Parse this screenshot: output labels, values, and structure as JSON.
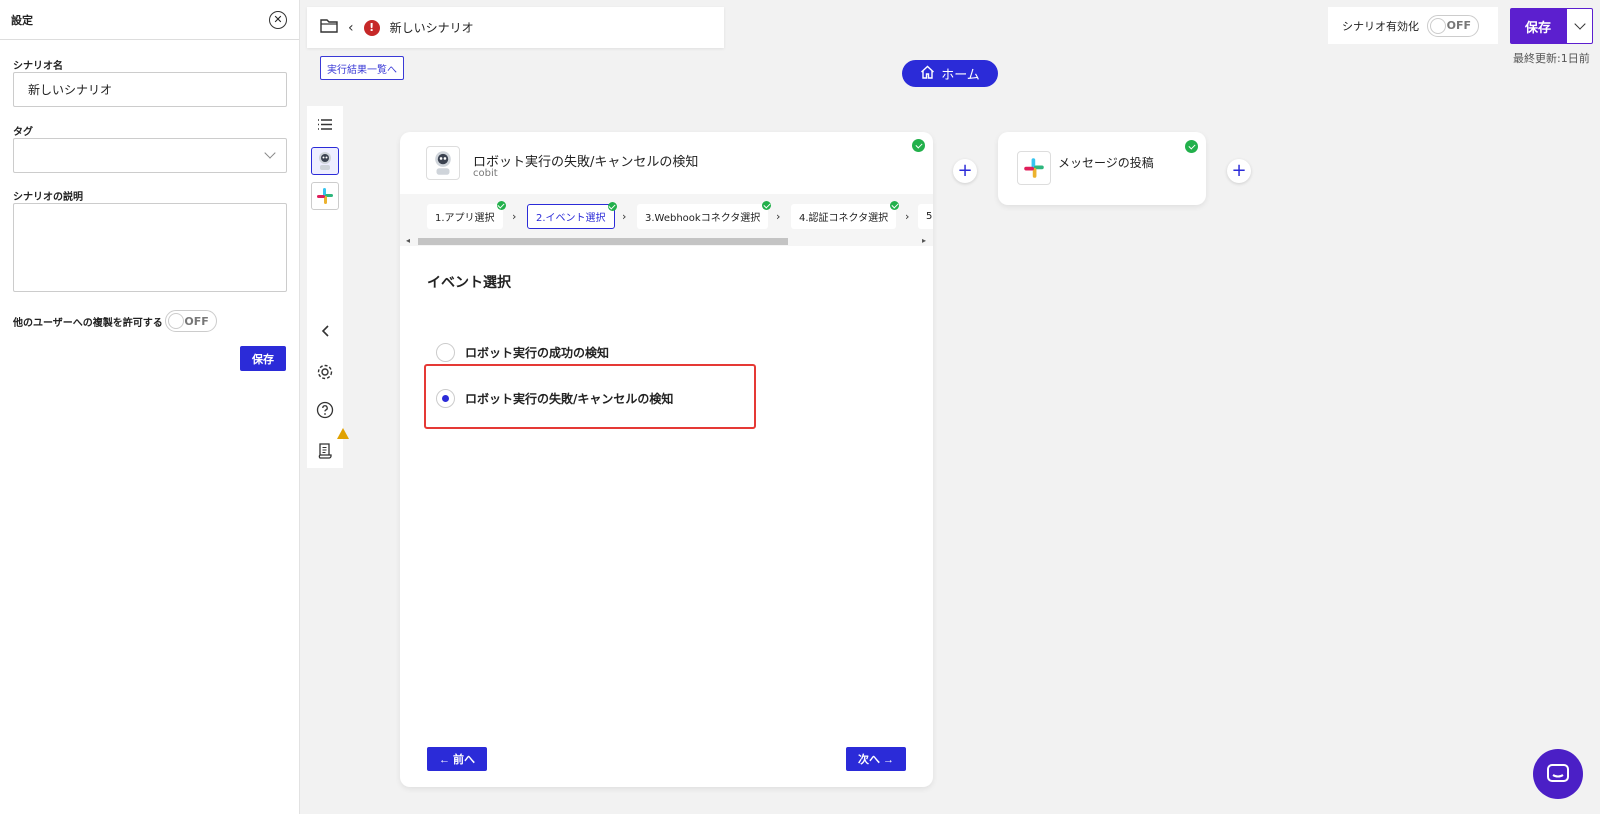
{
  "settings": {
    "title": "設定",
    "scenario_name_label": "シナリオ名",
    "scenario_name_value": "新しいシナリオ",
    "tag_label": "タグ",
    "description_label": "シナリオの説明",
    "copy_permission_label": "他のユーザーへの複製を許可する",
    "copy_toggle": "OFF",
    "save_label": "保存"
  },
  "header": {
    "scenario_name": "新しいシナリオ",
    "error_mark": "!",
    "results_link": "実行結果一覧へ",
    "home_label": "ホーム",
    "enable_label": "シナリオ有効化",
    "enable_toggle": "OFF",
    "save_label": "保存",
    "last_updated": "最終更新:1日前"
  },
  "card": {
    "title": "ロボット実行の失敗/キャンセルの検知",
    "subtitle": "cobit",
    "steps": [
      {
        "label": "1.アプリ選択"
      },
      {
        "label": "2.イベント選択"
      },
      {
        "label": "3.Webhookコネクタ選択"
      },
      {
        "label": "4.認証コネクタ選択"
      },
      {
        "label": "5"
      }
    ],
    "section_title": "イベント選択",
    "options": [
      {
        "label": "ロボット実行の成功の検知",
        "checked": false
      },
      {
        "label": "ロボット実行の失敗/キャンセルの検知",
        "checked": true
      }
    ],
    "prev_label": "← 前へ",
    "next_label": "次へ →"
  },
  "card2": {
    "title": "メッセージの投稿"
  },
  "colors": {
    "accent": "#2b2bd8",
    "save_purple": "#5c1fcf",
    "error_red": "#c62828",
    "highlight_red": "#e53935",
    "check_green": "#22b04b"
  }
}
